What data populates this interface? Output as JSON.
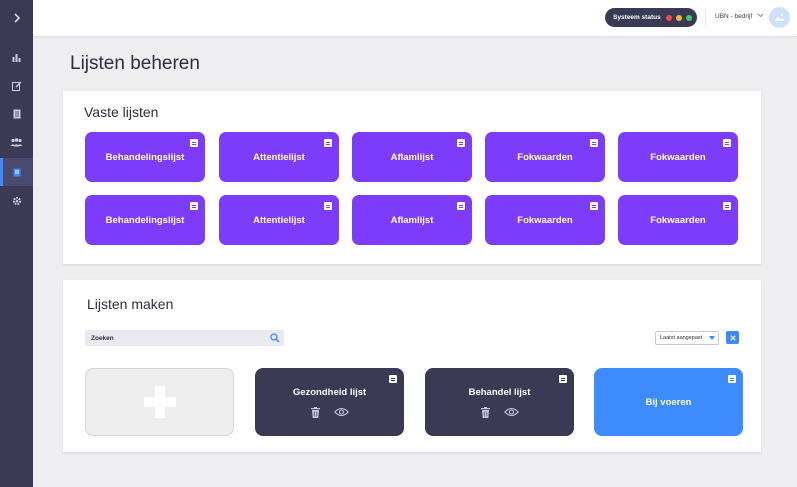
{
  "topbar": {
    "status_label": "Systeem status",
    "status_colors": [
      "#ef4b4b",
      "#f7b731",
      "#3fca6b"
    ],
    "company": "UBN - bedrijf"
  },
  "sidebar": {
    "items": [
      "chart-icon",
      "edit-icon",
      "document-icon",
      "users-icon",
      "list-icon",
      "gear-icon"
    ],
    "active": "list-icon"
  },
  "page": {
    "title": "Lijsten beheren"
  },
  "fixed_lists": {
    "title": "Vaste lijsten",
    "rows": [
      [
        "Behandelingslijst",
        "Attentielijst",
        "Aflamlijst",
        "Fokwaarden",
        "Fokwaarden"
      ],
      [
        "Behandelingslijst",
        "Attentielijst",
        "Aflamlijst",
        "Fokwaarden",
        "Fokwaarden"
      ]
    ],
    "accent": "#7c3cfa"
  },
  "create_lists": {
    "title": "Lijsten maken",
    "search_value": "Zoeken",
    "sort_value": "Laatst aangepast",
    "tiles": [
      {
        "label": "Gezondheid lijst"
      },
      {
        "label": "Behandel lijst"
      },
      {
        "label": "Bij voeren"
      }
    ]
  }
}
